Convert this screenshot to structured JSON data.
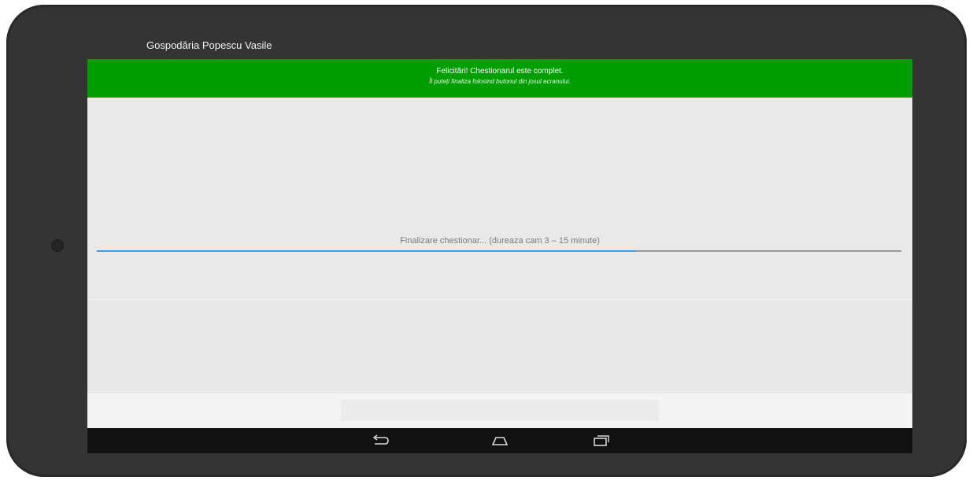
{
  "app": {
    "title": "Gospodăria Popescu Vasile"
  },
  "banner": {
    "title": "Felicitări! Chestionarul este complet.",
    "subtitle": "Îl puteți finaliza folosind butonul din josul ecranului.",
    "color": "#009e00"
  },
  "progress": {
    "label": "Finalizare chestionar... (dureaza cam 3 – 15 minute)",
    "fraction": 0.67,
    "fill_color": "#3d9be9",
    "track_color": "#9a9a9a"
  },
  "footer": {
    "button_label": "",
    "button_state": "disabled"
  },
  "nav": {
    "icons": [
      "back-icon",
      "home-icon",
      "recent-apps-icon"
    ]
  }
}
